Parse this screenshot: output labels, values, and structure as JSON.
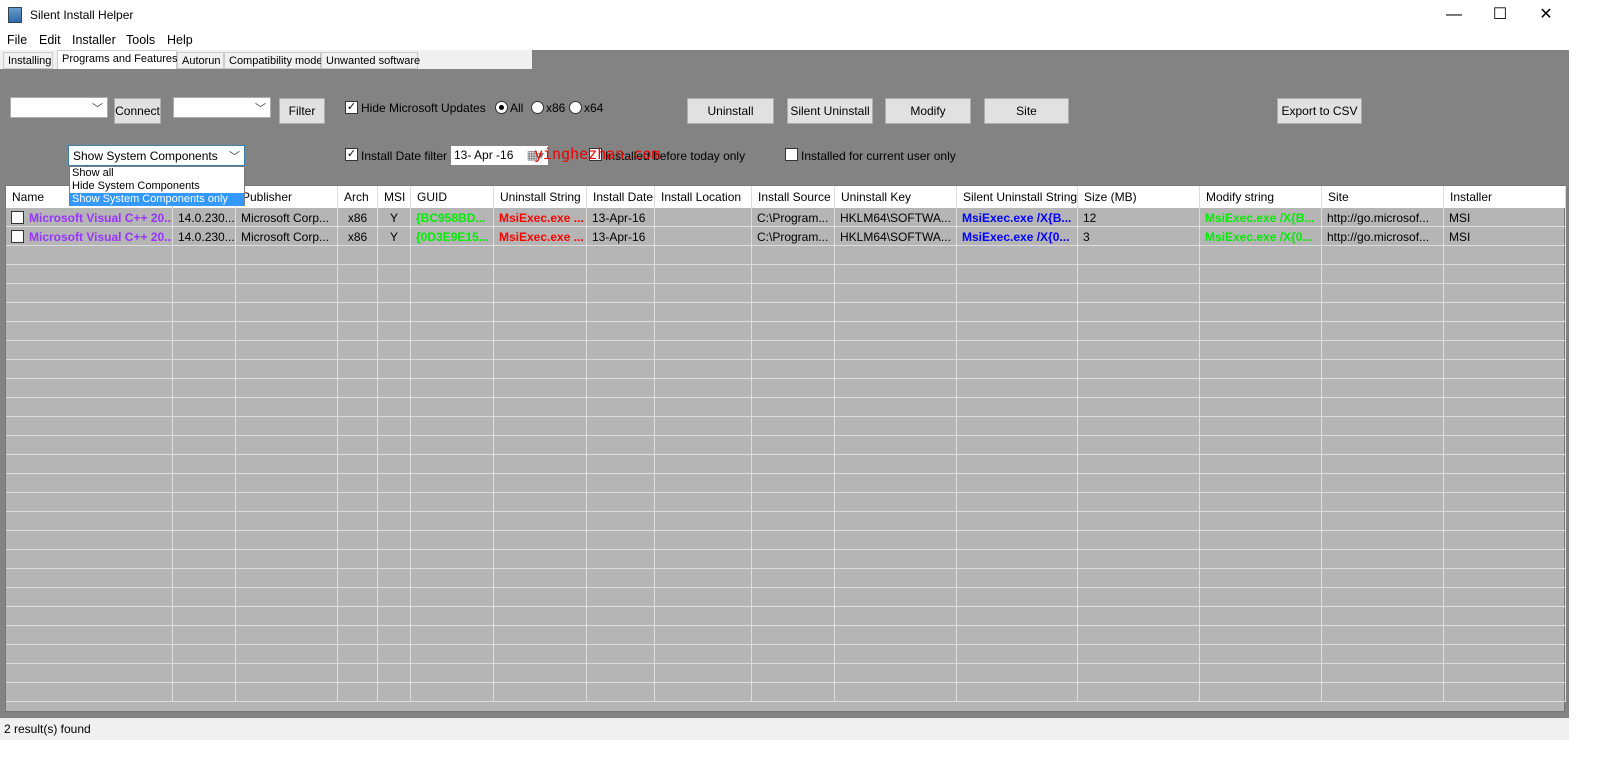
{
  "window": {
    "title": "Silent Install Helper",
    "minimize": "—",
    "maximize": "☐",
    "close": "✕"
  },
  "menu": [
    "File",
    "Edit",
    "Installer",
    "Tools",
    "Help"
  ],
  "tabs": [
    {
      "label": "Installing",
      "active": false
    },
    {
      "label": "Programs and Features",
      "active": true
    },
    {
      "label": "Autorun",
      "active": false
    },
    {
      "label": "Compatibility mode",
      "active": false
    },
    {
      "label": "Unwanted software",
      "active": false
    }
  ],
  "toolbar": {
    "connect": "Connect",
    "filter": "Filter",
    "hide_ms_updates": {
      "label": "Hide Microsoft Updates",
      "checked": true
    },
    "arch_radios": [
      {
        "label": "All",
        "checked": true
      },
      {
        "label": "x86",
        "checked": false
      },
      {
        "label": "x64",
        "checked": false
      }
    ],
    "uninstall": "Uninstall",
    "silent_uninstall": "Silent Uninstall",
    "modify": "Modify",
    "site": "Site",
    "export": "Export to CSV",
    "system_components": "Show System Components only",
    "system_options": [
      "Show all",
      "Hide System Components",
      "Show System Components only"
    ],
    "install_date_filter": {
      "label": "Install Date filter",
      "checked": true
    },
    "date": "13- Apr -16",
    "before_today": {
      "label": "Installed before today only",
      "checked": false
    },
    "current_user": {
      "label": "Installed for current user only",
      "checked": false
    }
  },
  "watermark": "yinghezhan.com",
  "colors": {
    "name": "#9933ff",
    "guid": "#00ee00",
    "uninstall": "#ff0000",
    "silent": "#0000ff",
    "modify": "#00ee00"
  },
  "grid": {
    "columns": [
      "Name",
      "",
      "Publisher",
      "Arch",
      "MSI",
      "GUID",
      "Uninstall String",
      "Install Date",
      "Install Location",
      "Install Source",
      "Uninstall Key",
      "Silent Uninstall String",
      "Size (MB)",
      "Modify string",
      "Site",
      "Installer"
    ],
    "rows": [
      [
        "Microsoft Visual C++ 20...",
        "14.0.230...",
        "Microsoft Corp...",
        "x86",
        "Y",
        "{BC958BD...",
        "MsiExec.exe ...",
        "13-Apr-16",
        "",
        "C:\\Program...",
        "HKLM64\\SOFTWA...",
        "MsiExec.exe /X{B...",
        "12",
        "MsiExec.exe /X{B...",
        "http://go.microsof...",
        "MSI"
      ],
      [
        "Microsoft Visual C++ 20...",
        "14.0.230...",
        "Microsoft Corp...",
        "x86",
        "Y",
        "{0D3E9E15...",
        "MsiExec.exe ...",
        "13-Apr-16",
        "",
        "C:\\Program...",
        "HKLM64\\SOFTWA...",
        "MsiExec.exe /X{0...",
        "3",
        "MsiExec.exe /X{0...",
        "http://go.microsof...",
        "MSI"
      ]
    ]
  },
  "status": "2 result(s) found"
}
